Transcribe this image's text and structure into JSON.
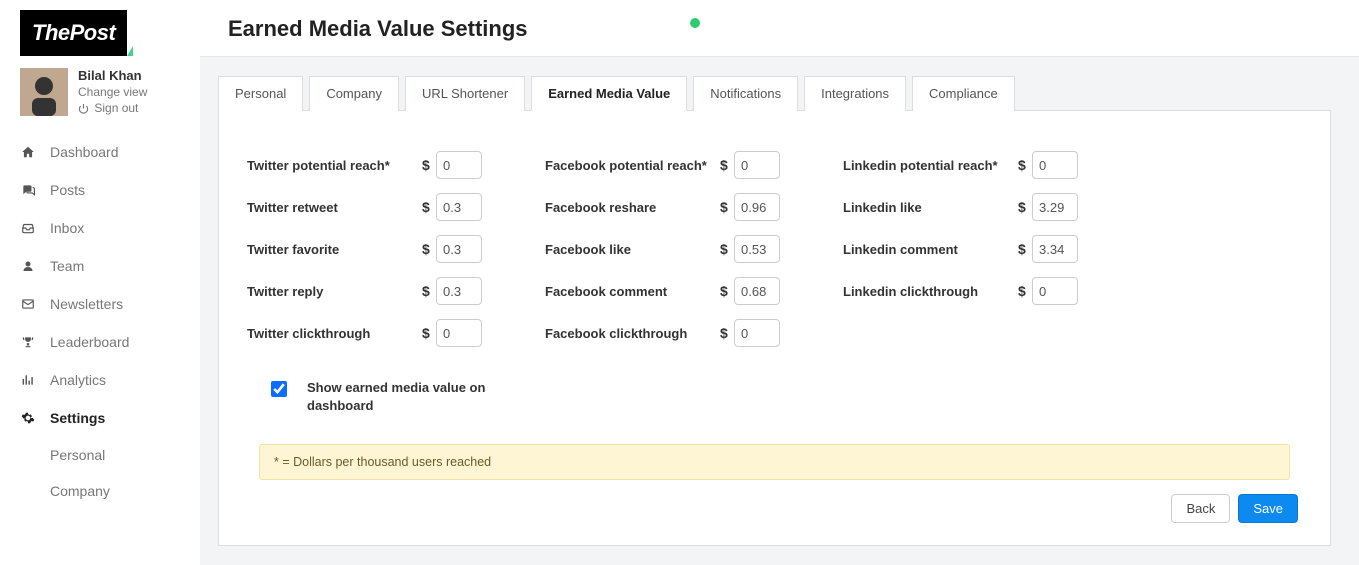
{
  "logo": "ThePost",
  "user": {
    "name": "Bilal Khan",
    "change_view": "Change view",
    "sign_out": "Sign out"
  },
  "nav": {
    "dashboard": "Dashboard",
    "posts": "Posts",
    "inbox": "Inbox",
    "team": "Team",
    "newsletters": "Newsletters",
    "leaderboard": "Leaderboard",
    "analytics": "Analytics",
    "settings": "Settings",
    "settings_sub": {
      "personal": "Personal",
      "company": "Company"
    }
  },
  "page": {
    "title": "Earned Media Value Settings"
  },
  "tabs": {
    "personal": "Personal",
    "company": "Company",
    "url_shortener": "URL Shortener",
    "emv": "Earned Media Value",
    "notifications": "Notifications",
    "integrations": "Integrations",
    "compliance": "Compliance"
  },
  "fields": {
    "twitter": {
      "potential_reach": {
        "label": "Twitter potential reach*",
        "value": "0"
      },
      "retweet": {
        "label": "Twitter retweet",
        "value": "0.3"
      },
      "favorite": {
        "label": "Twitter favorite",
        "value": "0.3"
      },
      "reply": {
        "label": "Twitter reply",
        "value": "0.3"
      },
      "clickthrough": {
        "label": "Twitter clickthrough",
        "value": "0"
      }
    },
    "facebook": {
      "potential_reach": {
        "label": "Facebook potential reach*",
        "value": "0"
      },
      "reshare": {
        "label": "Facebook reshare",
        "value": "0.96"
      },
      "like": {
        "label": "Facebook like",
        "value": "0.53"
      },
      "comment": {
        "label": "Facebook comment",
        "value": "0.68"
      },
      "clickthrough": {
        "label": "Facebook clickthrough",
        "value": "0"
      }
    },
    "linkedin": {
      "potential_reach": {
        "label": "Linkedin potential reach*",
        "value": "0"
      },
      "like": {
        "label": "Linkedin like",
        "value": "3.29"
      },
      "comment": {
        "label": "Linkedin comment",
        "value": "3.34"
      },
      "clickthrough": {
        "label": "Linkedin clickthrough",
        "value": "0"
      }
    },
    "currency": "$"
  },
  "checkbox": {
    "label": "Show earned media value on dashboard",
    "checked": true
  },
  "note": "* = Dollars per thousand users reached",
  "buttons": {
    "back": "Back",
    "save": "Save"
  }
}
